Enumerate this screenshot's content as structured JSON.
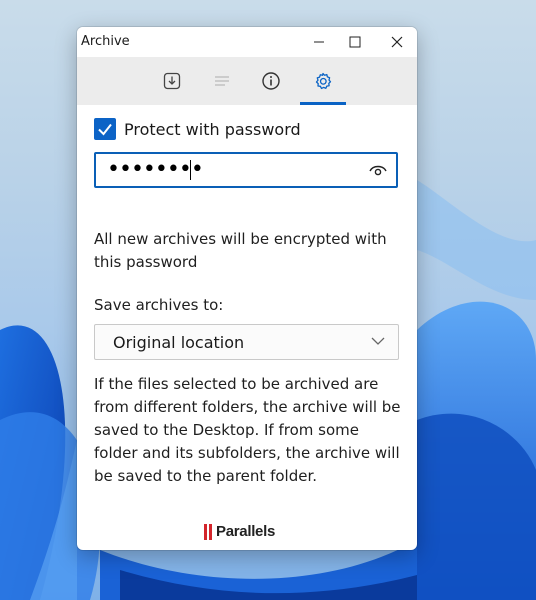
{
  "window": {
    "title": "Archive"
  },
  "tabs": [
    {
      "icon": "extract-icon",
      "active": false
    },
    {
      "icon": "list-icon",
      "active": false
    },
    {
      "icon": "info-icon",
      "active": false
    },
    {
      "icon": "gear-icon",
      "active": true
    }
  ],
  "settings": {
    "protect_label": "Protect with password",
    "protect_checked": true,
    "password_mask": "••••••••",
    "password_helper": "All new archives will be encrypted with this password",
    "save_label": "Save archives to:",
    "save_location": "Original location",
    "info": "If the files selected to be archived are from different folders, the archive will be saved to the Desktop. If from some folder and its subfolders, the archive will be saved to the parent folder."
  },
  "brand": {
    "name": "Parallels",
    "color": "#d3252b"
  },
  "colors": {
    "accent": "#0a63c5"
  }
}
